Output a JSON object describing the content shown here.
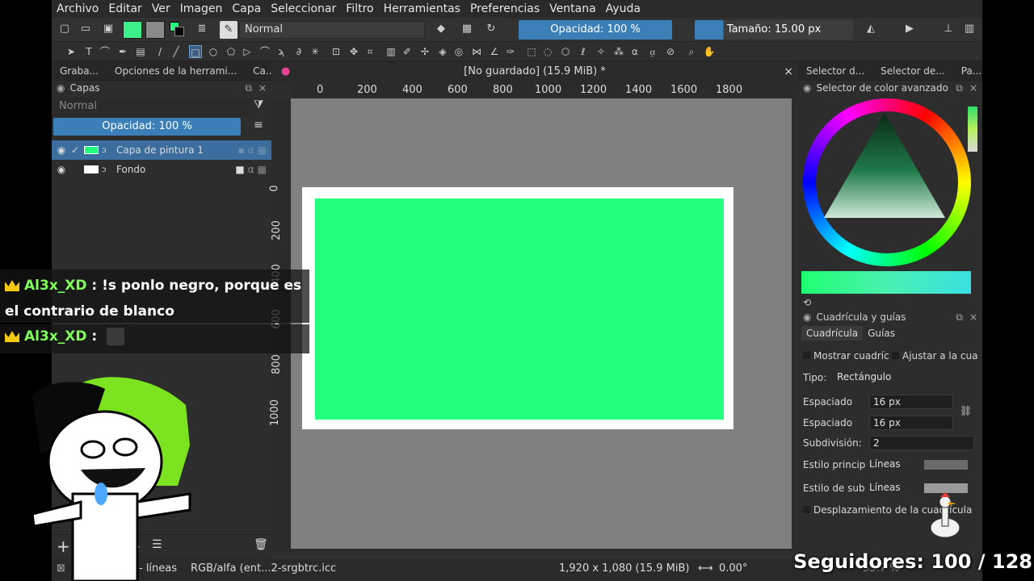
{
  "menu": [
    "Archivo",
    "Editar",
    "Ver",
    "Imagen",
    "Capa",
    "Seleccionar",
    "Filtro",
    "Herramientas",
    "Preferencias",
    "Ventana",
    "Ayuda"
  ],
  "toolbar": {
    "blend_mode": "Normal",
    "opacity": "Opacidad: 100 %",
    "size": "Tamaño: 15.00 px"
  },
  "left_dock": {
    "tabs": [
      "Graba...",
      "Opciones de la herrami...",
      "Ca..."
    ],
    "panel_title": "Capas",
    "blend_mode": "Normal",
    "opacity": "Opacidad: 100 %",
    "layers": [
      {
        "name": "Capa de pintura 1",
        "color": "#22ff7f",
        "active": true
      },
      {
        "name": "Fondo",
        "color": "#ffffff",
        "active": false
      }
    ]
  },
  "canvas": {
    "doc_title": "[No guardado]  (15.9 MiB) *",
    "ruler_h": [
      "0",
      "200",
      "400",
      "600",
      "800",
      "1000",
      "1200",
      "1400",
      "1600",
      "1800"
    ],
    "ruler_v": [
      "0",
      "200",
      "400",
      "600",
      "800",
      "1000"
    ],
    "fill_color": "#22ff7f",
    "paper_color": "#ffffff"
  },
  "right_dock": {
    "tabs": [
      "Selector d...",
      "Selector de...",
      "Pa..."
    ],
    "color_title": "Selector de color avanzado",
    "grid_title": "Cuadrícula y guías",
    "grid_tabs": [
      "Cuadrícula",
      "Guías"
    ],
    "show_grid": "Mostrar cuadríc",
    "snap_grid": "Ajustar a la cua",
    "type_label": "Tipo:",
    "type_value": "Rectángulo",
    "spacing_label": "Espaciado",
    "spacing_x": "16 px",
    "spacing_y": "16 px",
    "subdivision_label": "Subdivisión:",
    "subdivision_value": "2",
    "main_style_label": "Estilo princip:",
    "main_style_value": "Líneas",
    "sub_style_label": "Estilo de sub:",
    "sub_style_value": "Líneas",
    "offset_label": "Desplazamiento de la cuadrícula"
  },
  "status": {
    "lines": "- líneas",
    "color_profile": "RGB/alfa (ent...2-srgbtrc.icc",
    "dimensions": "1,920 x 1,080 (15.9 MiB)",
    "rotation": "0.00°",
    "zoom": "55.7 %"
  },
  "chat": {
    "msg1_user": "Al3x_XD",
    "msg1_text": ": !s ponlo negro, porque es el contrario de blanco",
    "msg2_user": "Al3x_XD",
    "msg2_text": ":"
  },
  "overlay": {
    "followers": "Seguidores: 100 / 128"
  },
  "colors": {
    "accent": "#3b7fb8",
    "paint": "#22ff7f",
    "chat_user": "#7fff5a"
  }
}
